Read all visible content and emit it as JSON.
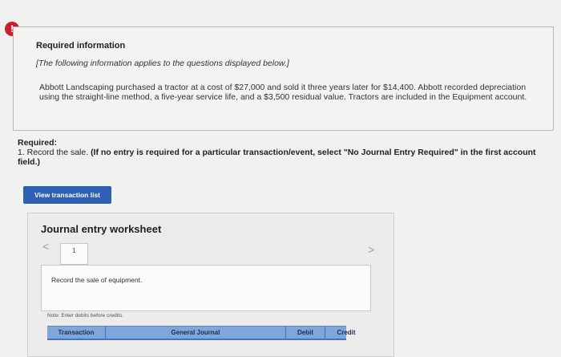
{
  "alert": {
    "symbol": "!"
  },
  "info": {
    "title": "Required information",
    "subtitle": "[The following information applies to the questions displayed below.]",
    "body": "Abbott Landscaping purchased a tractor at a cost of $27,000 and sold it three years later for $14,400. Abbott recorded depreciation using the straight-line method, a five-year service life, and a $3,500 residual value. Tractors are included in the Equipment account."
  },
  "required": {
    "label": "Required:",
    "item": "1. Record the sale.",
    "instruction": "(If no entry is required for a particular transaction/event, select \"No Journal Entry Required\" in the first account field.)"
  },
  "view_button": {
    "label": "View transaction list"
  },
  "worksheet": {
    "title": "Journal entry worksheet",
    "prev_icon": "<",
    "next_icon": ">",
    "current_page": "1",
    "entry_description": "Record the sale of equipment.",
    "note": "Note: Enter debits before credits.",
    "columns": [
      "Transaction",
      "General Journal",
      "Debit",
      "Credit"
    ]
  },
  "colors": {
    "alert_red": "#c62032",
    "button_blue": "#2e5fb0",
    "header_blue": "#7ea5dc"
  }
}
